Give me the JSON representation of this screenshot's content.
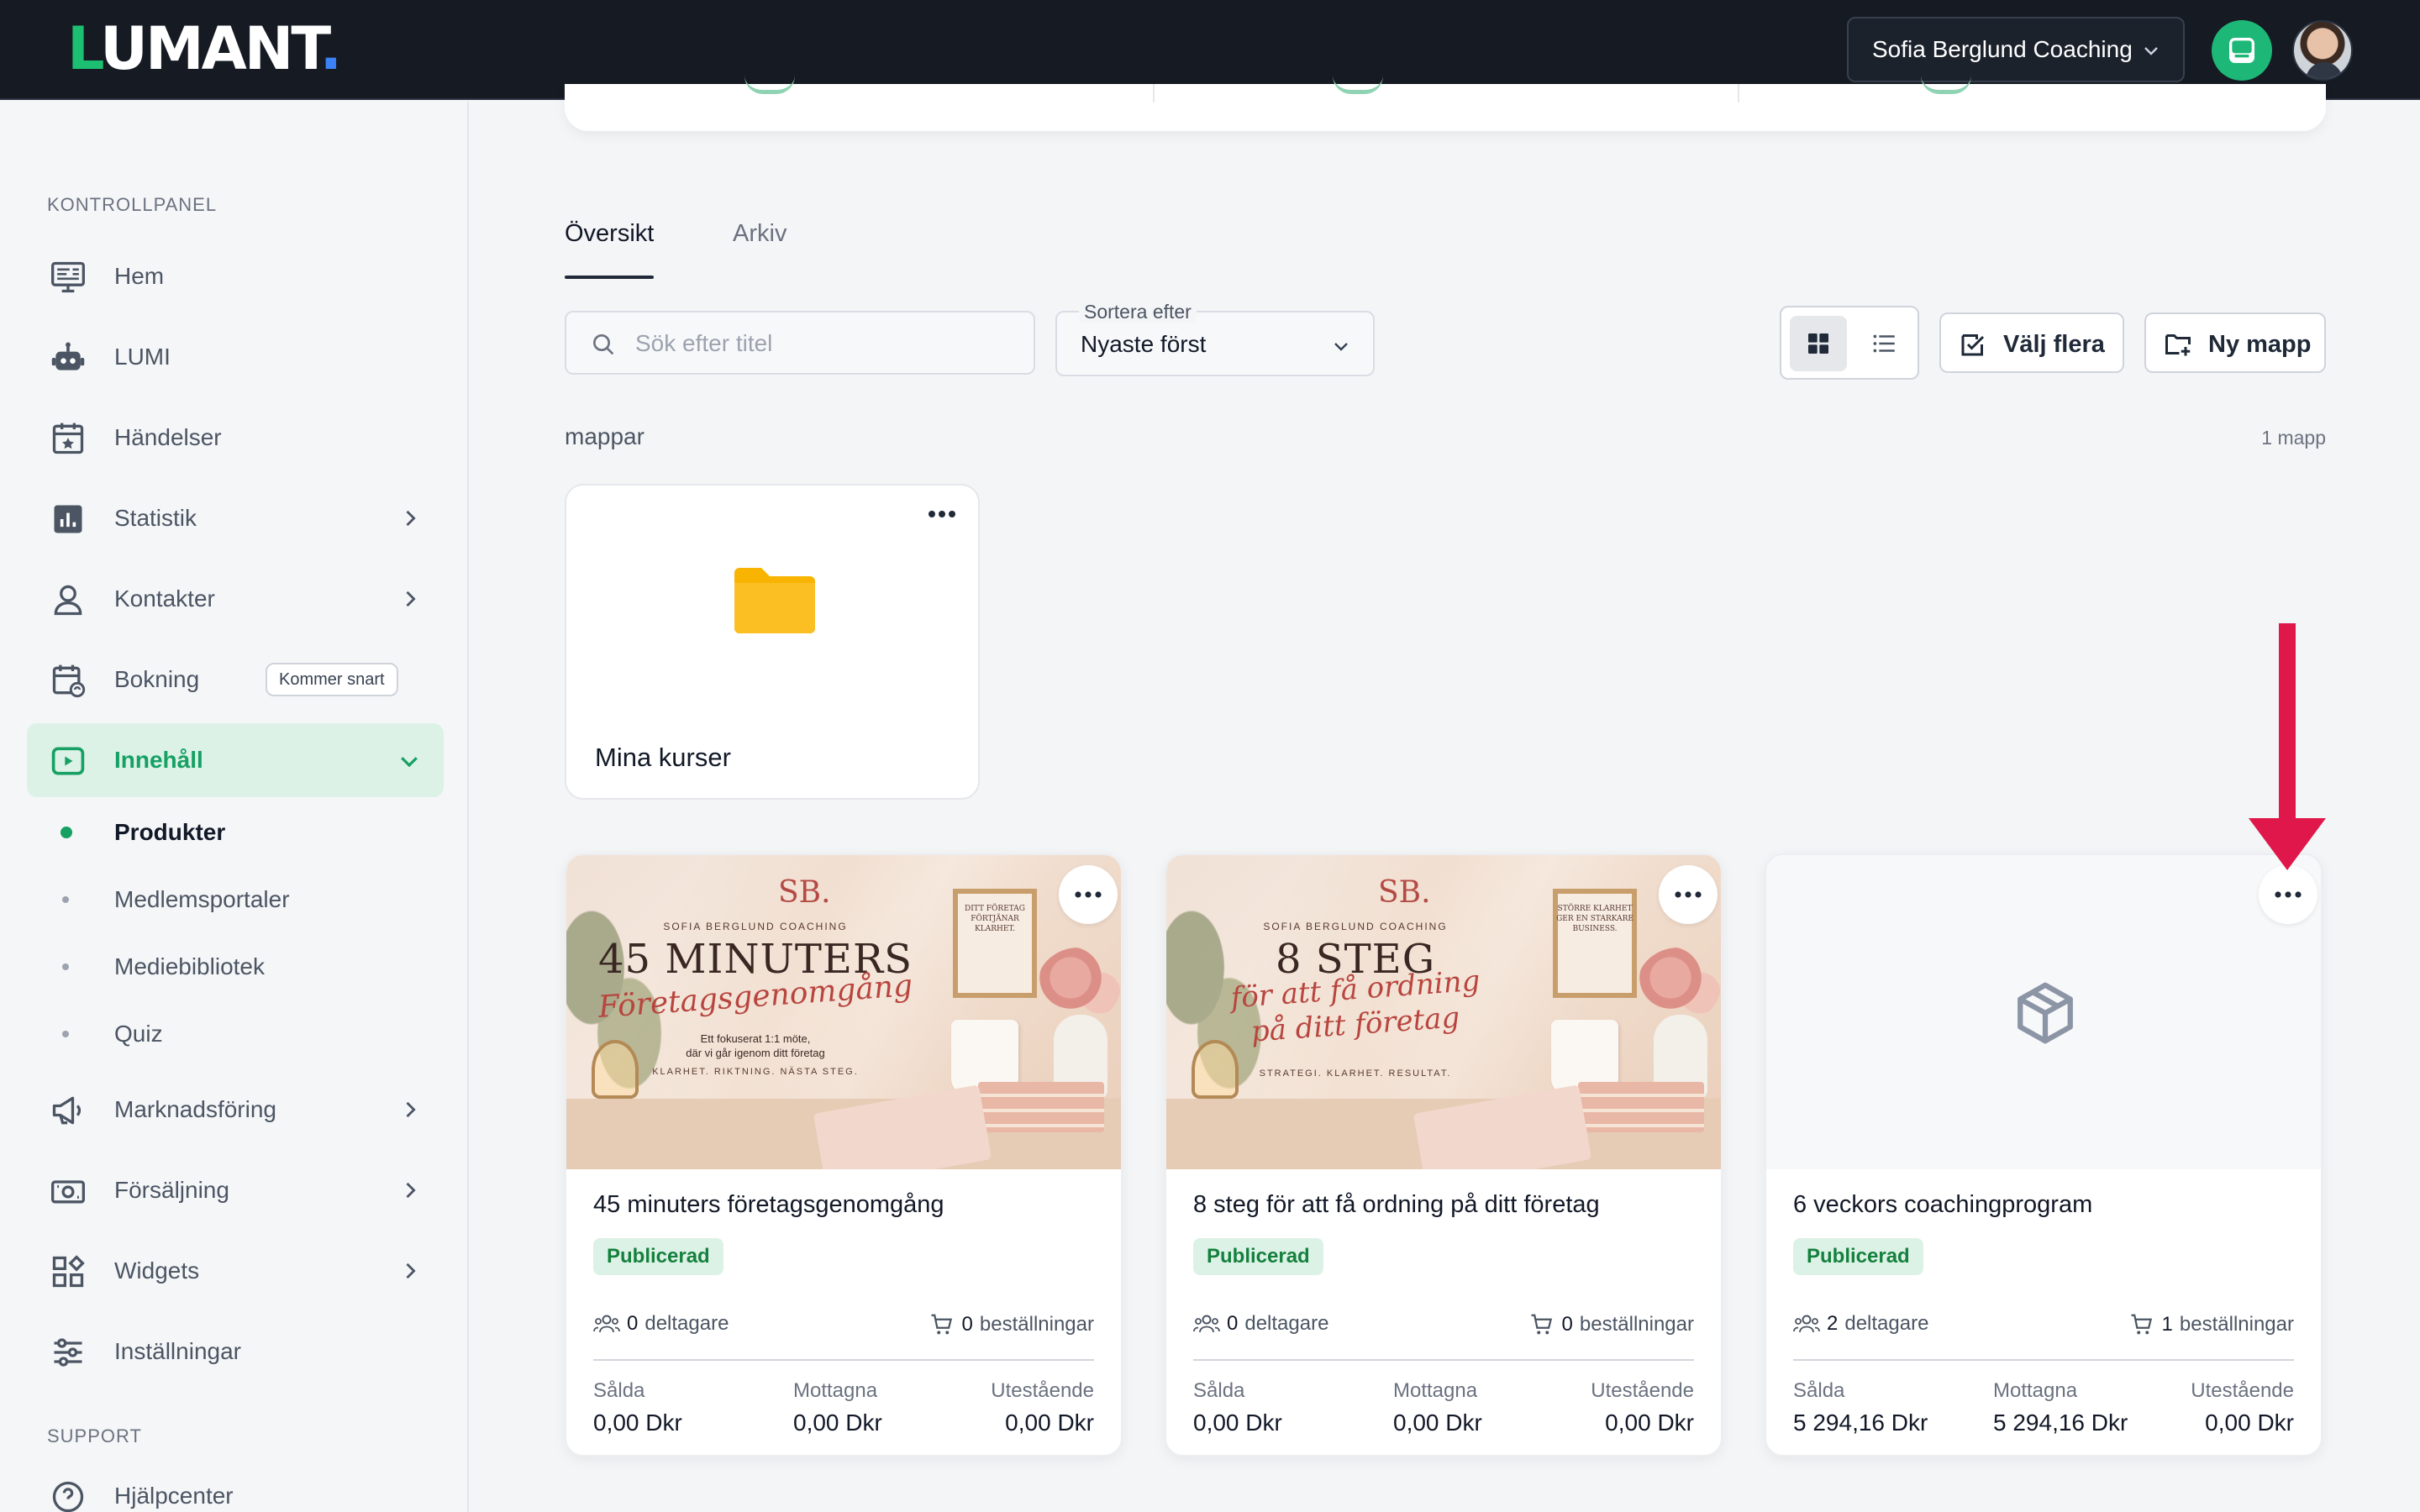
{
  "header": {
    "logo": {
      "first_letter": "L",
      "rest": "UMANT",
      "dot": "."
    },
    "org_name": "Sofia Berglund Coaching",
    "icons": {
      "org_chevron": "chevron-down-icon",
      "chat": "chat-icon",
      "avatar": "user-avatar"
    }
  },
  "sidebar": {
    "section_main": "KONTROLLPANEL",
    "items": [
      {
        "label": "Hem",
        "icon": "monitor-icon"
      },
      {
        "label": "LUMI",
        "icon": "robot-icon"
      },
      {
        "label": "Händelser",
        "icon": "calendar-star-icon"
      },
      {
        "label": "Statistik",
        "icon": "chart-icon"
      },
      {
        "label": "Kontakter",
        "icon": "person-icon"
      },
      {
        "label": "Bokning",
        "icon": "calendar-sync-icon",
        "badge": "Kommer snart"
      },
      {
        "label": "Innehåll",
        "icon": "play-icon"
      },
      {
        "label": "Marknadsföring",
        "icon": "megaphone-icon"
      },
      {
        "label": "Försäljning",
        "icon": "cash-icon"
      },
      {
        "label": "Widgets",
        "icon": "widgets-icon"
      },
      {
        "label": "Inställningar",
        "icon": "sliders-icon"
      }
    ],
    "content_sub": [
      {
        "label": "Produkter"
      },
      {
        "label": "Medlemsportaler"
      },
      {
        "label": "Mediebibliotek"
      },
      {
        "label": "Quiz"
      }
    ],
    "section_support": "SUPPORT",
    "support_items": [
      {
        "label": "Hjälpcenter",
        "icon": "help-icon"
      }
    ]
  },
  "main": {
    "tabs": [
      {
        "label": "Översikt",
        "active": true
      },
      {
        "label": "Arkiv",
        "active": false
      }
    ],
    "search": {
      "placeholder": "Sök efter titel",
      "value": ""
    },
    "sort": {
      "caption": "Sortera efter",
      "value": "Nyaste först"
    },
    "view_mode": "grid",
    "buttons": {
      "select_multiple": "Välj flera",
      "new_folder": "Ny mapp"
    },
    "folders": {
      "heading": "mappar",
      "count": "1 mapp",
      "items": [
        {
          "name": "Mina kurser"
        }
      ]
    },
    "products": [
      {
        "title": "45 minuters företagsgenomgång",
        "status": "Publicerad",
        "participants": "0",
        "participants_label": "deltagare",
        "orders": "0",
        "orders_label": "beställningar",
        "fin": [
          {
            "caption": "Sålda",
            "value": "0,00 Dkr"
          },
          {
            "caption": "Mottagna",
            "value": "0,00 Dkr"
          },
          {
            "caption": "Utestående",
            "value": "0,00 Dkr"
          }
        ],
        "thumb": {
          "monogram": "SB.",
          "brand": "SOFIA BERGLUND COACHING",
          "headline": "45 MINUTERS",
          "script": "Företagsgenomgång",
          "sub1": "Ett fokuserat 1:1 möte,",
          "sub2": "där vi går igenom ditt företag",
          "tagline": "KLARHET. RIKTNING. NÄSTA STEG.",
          "note": "DITT FÖRETAG FÖRTJÄNAR KLARHET."
        }
      },
      {
        "title": "8 steg för att få ordning på ditt företag",
        "status": "Publicerad",
        "participants": "0",
        "participants_label": "deltagare",
        "orders": "0",
        "orders_label": "beställningar",
        "fin": [
          {
            "caption": "Sålda",
            "value": "0,00 Dkr"
          },
          {
            "caption": "Mottagna",
            "value": "0,00 Dkr"
          },
          {
            "caption": "Utestående",
            "value": "0,00 Dkr"
          }
        ],
        "thumb": {
          "monogram": "SB.",
          "brand": "SOFIA BERGLUND COACHING",
          "headline": "8 STEG",
          "script": "för att få ordning",
          "script2": "på ditt företag",
          "tagline": "STRATEGI. KLARHET. RESULTAT.",
          "note": "STÖRRE KLARHET GER EN STARKARE BUSINESS."
        }
      },
      {
        "title": "6 veckors coachingprogram",
        "status": "Publicerad",
        "participants": "2",
        "participants_label": "deltagare",
        "orders": "1",
        "orders_label": "beställningar",
        "fin": [
          {
            "caption": "Sålda",
            "value": "5 294,16 Dkr"
          },
          {
            "caption": "Mottagna",
            "value": "5 294,16 Dkr"
          },
          {
            "caption": "Utestående",
            "value": "0,00 Dkr"
          }
        ],
        "thumb": {
          "placeholder_icon": "package-icon"
        }
      }
    ]
  },
  "colors": {
    "topbar": "#161b23",
    "brand_green": "#1dbf73",
    "active_bg": "#dcf2e6",
    "status_text": "#15803d",
    "annotation_arrow": "#e0174a"
  }
}
